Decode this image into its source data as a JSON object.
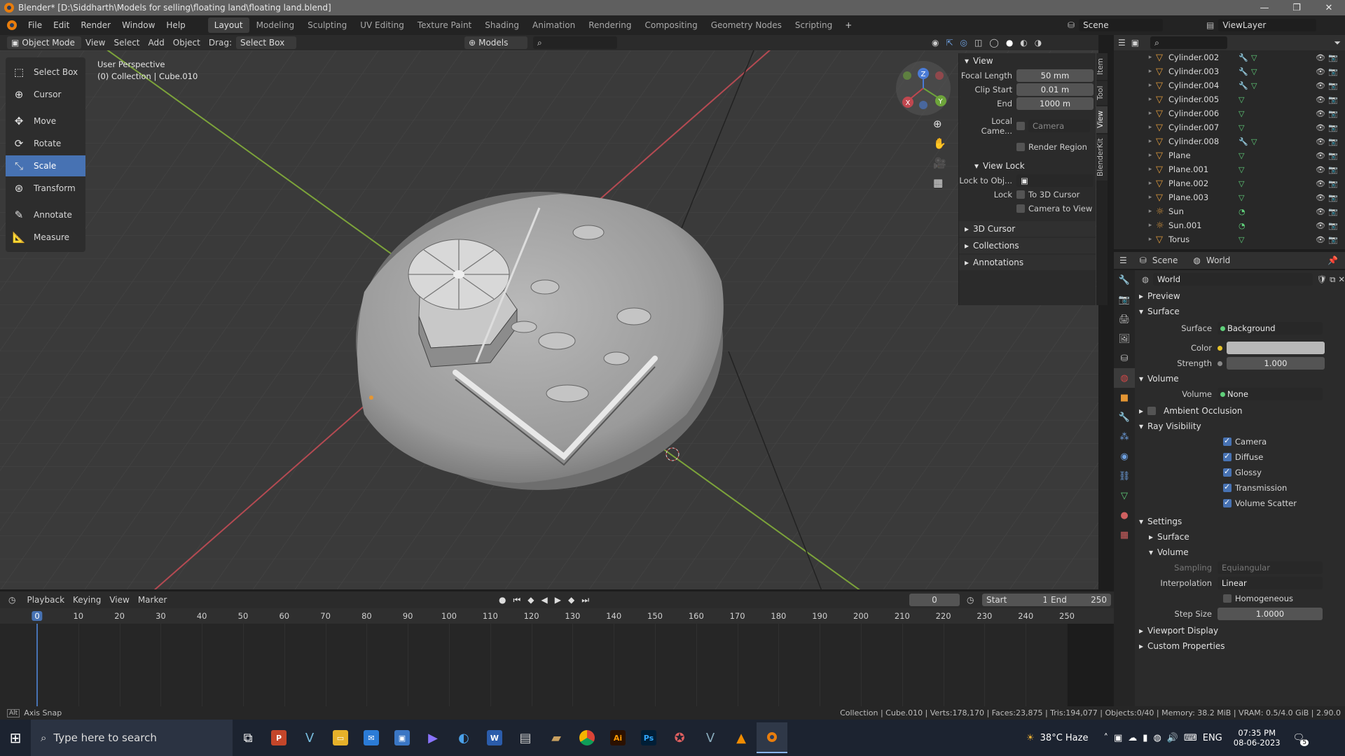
{
  "window": {
    "title": "Blender* [D:\\Siddharth\\Models for selling\\floating land\\floating land.blend]",
    "minimize": "—",
    "maximize": "❐",
    "close": "✕"
  },
  "menu": [
    "File",
    "Edit",
    "Render",
    "Window",
    "Help"
  ],
  "workspaces": [
    "Layout",
    "Modeling",
    "Sculpting",
    "UV Editing",
    "Texture Paint",
    "Shading",
    "Animation",
    "Rendering",
    "Compositing",
    "Geometry Nodes",
    "Scripting"
  ],
  "active_workspace": "Layout",
  "scene": {
    "label": "Scene",
    "viewlayer": "ViewLayer"
  },
  "header3d": {
    "mode": "Object Mode",
    "view": "View",
    "select": "Select",
    "add": "Add",
    "object": "Object",
    "drag_label": "Drag:",
    "drag_value": "Select Box",
    "orientation": "Models"
  },
  "tools": [
    {
      "name": "Select Box",
      "icon": "⬚"
    },
    {
      "name": "Cursor",
      "icon": "⊕"
    },
    {
      "name": "Move",
      "icon": "✥"
    },
    {
      "name": "Rotate",
      "icon": "⟳"
    },
    {
      "name": "Scale",
      "icon": "⤡"
    },
    {
      "name": "Transform",
      "icon": "⊛"
    },
    {
      "name": "Annotate",
      "icon": "✎"
    },
    {
      "name": "Measure",
      "icon": "📐"
    }
  ],
  "active_tool": "Scale",
  "viewport": {
    "perspective": "User Perspective",
    "collection": "(0) Collection | Cube.010"
  },
  "npanel": {
    "view_title": "View",
    "focal_length_label": "Focal Length",
    "focal_length": "50 mm",
    "clip_start_label": "Clip Start",
    "clip_start": "0.01 m",
    "end_label": "End",
    "end": "1000 m",
    "local_camera_label": "Local Came...",
    "camera_placeholder": "Camera",
    "render_region": "Render Region",
    "view_lock_title": "View Lock",
    "lock_to_obj_label": "Lock to Obj...",
    "lock_label": "Lock",
    "to_3d_cursor": "To 3D Cursor",
    "camera_to_view": "Camera to View",
    "cursor_3d": "3D Cursor",
    "collections": "Collections",
    "annotations": "Annotations"
  },
  "npanel_tabs": [
    "Item",
    "Tool",
    "View",
    "BlenderKit"
  ],
  "outliner_items": [
    {
      "name": "Cylinder.002",
      "mod": true
    },
    {
      "name": "Cylinder.003",
      "mod": true
    },
    {
      "name": "Cylinder.004",
      "mod": true
    },
    {
      "name": "Cylinder.005",
      "mod": false
    },
    {
      "name": "Cylinder.006",
      "mod": false
    },
    {
      "name": "Cylinder.007",
      "mod": false
    },
    {
      "name": "Cylinder.008",
      "mod": true
    },
    {
      "name": "Plane",
      "mod": false
    },
    {
      "name": "Plane.001",
      "mod": false
    },
    {
      "name": "Plane.002",
      "mod": false
    },
    {
      "name": "Plane.003",
      "mod": false
    },
    {
      "name": "Sun",
      "mod": false
    },
    {
      "name": "Sun.001",
      "mod": false
    },
    {
      "name": "Torus",
      "mod": false
    }
  ],
  "props": {
    "breadcrumb_scene": "Scene",
    "breadcrumb_world": "World",
    "world_name": "World",
    "preview": "Preview",
    "surface_sec": "Surface",
    "surface_label": "Surface",
    "surface_value": "Background",
    "color_label": "Color",
    "color_value": "#b8b8b8",
    "strength_label": "Strength",
    "strength_value": "1.000",
    "volume_sec": "Volume",
    "volume_label": "Volume",
    "volume_value": "None",
    "ambient_occlusion": "Ambient Occlusion",
    "ray_visibility": "Ray Visibility",
    "rays": [
      "Camera",
      "Diffuse",
      "Glossy",
      "Transmission",
      "Volume Scatter"
    ],
    "settings": "Settings",
    "settings_surface": "Surface",
    "settings_volume": "Volume",
    "sampling_label": "Sampling",
    "sampling_value": "Equiangular",
    "interp_label": "Interpolation",
    "interp_value": "Linear",
    "homogeneous": "Homogeneous",
    "step_label": "Step Size",
    "step_value": "1.0000",
    "viewport_display": "Viewport Display",
    "custom_properties": "Custom Properties"
  },
  "timeline": {
    "playback": "Playback",
    "keying": "Keying",
    "view": "View",
    "marker": "Marker",
    "current_frame": "0",
    "start_label": "Start",
    "start": "1",
    "end_label": "End",
    "end": "250",
    "ticks": [
      "0",
      "10",
      "20",
      "30",
      "40",
      "50",
      "60",
      "70",
      "80",
      "90",
      "100",
      "110",
      "120",
      "130",
      "140",
      "150",
      "160",
      "170",
      "180",
      "190",
      "200",
      "210",
      "220",
      "230",
      "240",
      "250"
    ]
  },
  "status": {
    "left": "Axis Snap",
    "right": "Collection | Cube.010 | Verts:178,170 | Faces:23,875 | Tris:194,077 | Objects:0/40 | Memory: 38.2 MiB | VRAM: 0.5/4.0 GiB | 2.90.0"
  },
  "taskbar": {
    "search_placeholder": "Type here to search",
    "weather": "38°C  Haze",
    "lang": "ENG",
    "time": "07:35 PM",
    "date": "08-06-2023",
    "notif": "5"
  }
}
